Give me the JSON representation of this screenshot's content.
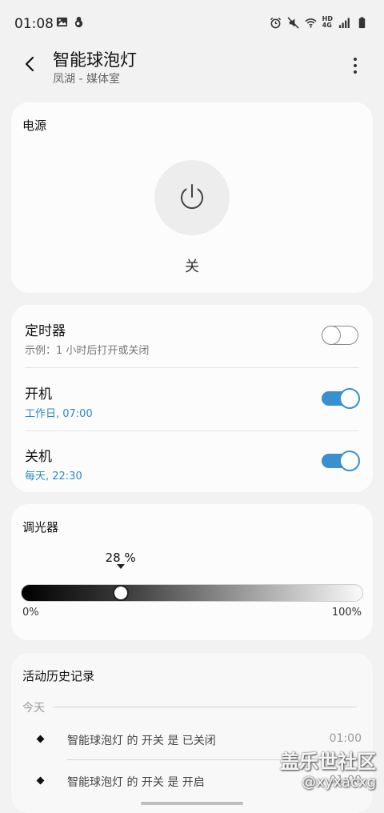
{
  "status_bar": {
    "time": "01:08",
    "hd": "HD",
    "network": "4G",
    "icons": [
      "image-icon",
      "notification-icon",
      "alarm-icon",
      "mute-icon",
      "wifi-icon",
      "signal-icon",
      "battery-icon"
    ]
  },
  "app_bar": {
    "title": "智能球泡灯",
    "subtitle": "凤湖 - 媒体室"
  },
  "power": {
    "title": "电源",
    "state": "关"
  },
  "timer": {
    "rows": [
      {
        "title": "定时器",
        "subtitle": "示例：1 小时后打开或关闭",
        "on": false
      },
      {
        "title": "开机",
        "subtitle": "工作日, 07:00",
        "on": true
      },
      {
        "title": "关机",
        "subtitle": "每天, 22:30",
        "on": true
      }
    ]
  },
  "dimmer": {
    "title": "调光器",
    "value_text": "28 %",
    "level": 0.28,
    "min_label": "0%",
    "max_label": "100%"
  },
  "history": {
    "title": "活动历史记录",
    "date": "今天",
    "items": [
      {
        "text": "智能球泡灯 的 开关 是 已关闭",
        "time": "01:00"
      },
      {
        "text": "智能球泡灯 的 开关 是 开启",
        "time": "01:00"
      }
    ]
  },
  "watermark": {
    "line1": "盖乐世社区",
    "line2": "@xyxacxg"
  },
  "colors": {
    "accent": "#3a8fd0",
    "link": "#2a8bc6",
    "background": "#f2f2f2",
    "card": "#fcfcfc"
  }
}
